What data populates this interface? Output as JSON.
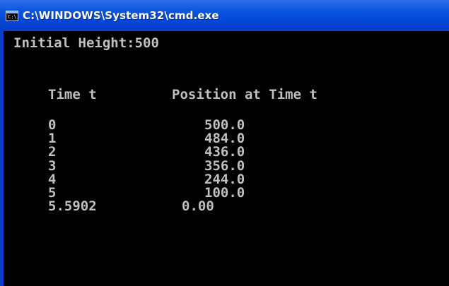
{
  "window": {
    "title": "C:\\WINDOWS\\System32\\cmd.exe",
    "icon": "cmd-icon",
    "icon_text": "C:\\"
  },
  "console": {
    "initial_height_line": "Initial Height:500",
    "header_time": "Time t",
    "header_position": "Position at Time t",
    "rows": [
      {
        "time": "0",
        "position": "500.0"
      },
      {
        "time": "1",
        "position": "484.0"
      },
      {
        "time": "2",
        "position": "436.0"
      },
      {
        "time": "3",
        "position": "356.0"
      },
      {
        "time": "4",
        "position": "244.0"
      },
      {
        "time": "5",
        "position": "100.0"
      },
      {
        "time": "5.5902",
        "position": "0.00"
      }
    ],
    "colors": {
      "background": "#000000",
      "text": "#c0c0c0",
      "titlebar": "#0b55e0"
    }
  }
}
